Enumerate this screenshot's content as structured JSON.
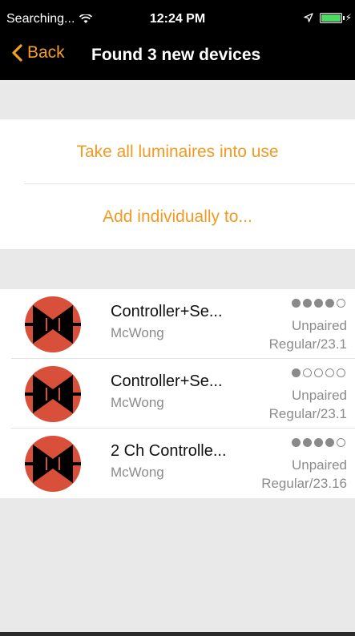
{
  "status_bar": {
    "carrier": "Searching...",
    "time": "12:24 PM",
    "icons": [
      "wifi-icon",
      "location-arrow-icon",
      "battery-icon",
      "charging-bolt-icon"
    ]
  },
  "nav": {
    "back_label": "Back",
    "title": "Found 3 new devices"
  },
  "actions": [
    {
      "label": "Take all luminaires into use"
    },
    {
      "label": "Add individually to..."
    }
  ],
  "devices": [
    {
      "name": "Controller+Se...",
      "owner": "McWong",
      "status": "Unpaired",
      "type": "Regular/23.1",
      "signal_strength": 4,
      "signal_max": 5
    },
    {
      "name": "Controller+Se...",
      "owner": "McWong",
      "status": "Unpaired",
      "type": "Regular/23.1",
      "signal_strength": 1,
      "signal_max": 5
    },
    {
      "name": "2 Ch Controlle...",
      "owner": "McWong",
      "status": "Unpaired",
      "type": "Regular/23.16",
      "signal_strength": 4,
      "signal_max": 5
    }
  ],
  "colors": {
    "accent": "#f29a22",
    "device_icon_red": "#d9503a",
    "device_icon_black": "#000000",
    "background": "#e9e9e9"
  }
}
